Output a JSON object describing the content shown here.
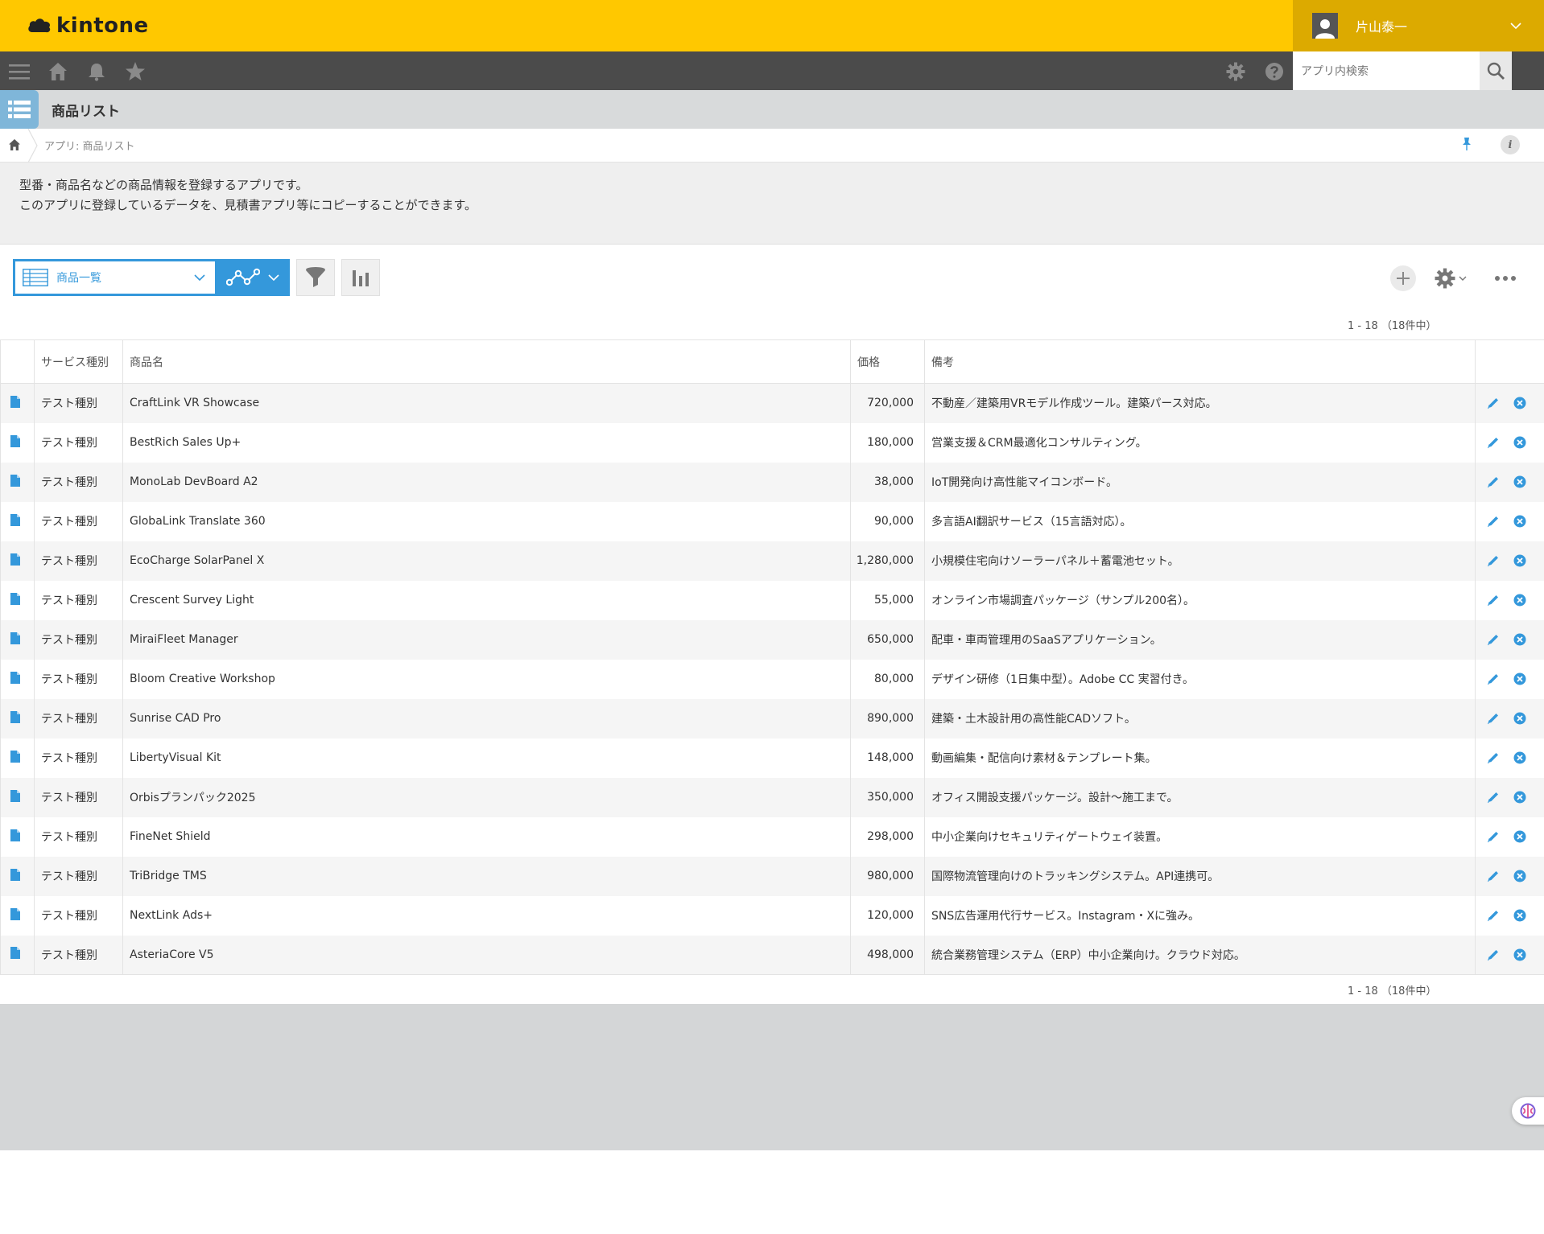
{
  "app": {
    "logo_text": "kintone",
    "title": "商品リスト"
  },
  "user": {
    "name": "片山泰一"
  },
  "search": {
    "placeholder": "アプリ内検索"
  },
  "breadcrumb": {
    "text": "アプリ: 商品リスト"
  },
  "description": {
    "line1": "型番・商品名などの商品情報を登録するアプリです。",
    "line2": "このアプリに登録しているデータを、見積書アプリ等にコピーすることができます。"
  },
  "view": {
    "selected": "商品一覧"
  },
  "pager": {
    "top": "1 - 18 （18件中）",
    "bottom": "1 - 18 （18件中）"
  },
  "colors": {
    "header_yellow": "#ffc800",
    "nav_dark": "#4b4b4b",
    "accent_blue": "#3498db"
  },
  "icons": [
    "menu-icon",
    "home-icon",
    "bell-icon",
    "star-icon",
    "gear-icon",
    "help-icon",
    "search-icon",
    "pin-icon",
    "info-icon",
    "record-icon",
    "pencil-icon",
    "close-icon"
  ],
  "table": {
    "headers": {
      "service_type": "サービス種別",
      "product_name": "商品名",
      "price": "価格",
      "notes": "備考"
    },
    "rows": [
      {
        "service_type": "テスト種別",
        "product_name": "CraftLink VR Showcase",
        "price": "720,000",
        "notes": "不動産／建築用VRモデル作成ツール。建築パース対応。"
      },
      {
        "service_type": "テスト種別",
        "product_name": "BestRich Sales Up+",
        "price": "180,000",
        "notes": "営業支援＆CRM最適化コンサルティング。"
      },
      {
        "service_type": "テスト種別",
        "product_name": "MonoLab DevBoard A2",
        "price": "38,000",
        "notes": "IoT開発向け高性能マイコンボード。"
      },
      {
        "service_type": "テスト種別",
        "product_name": "GlobaLink Translate 360",
        "price": "90,000",
        "notes": "多言語AI翻訳サービス（15言語対応）。"
      },
      {
        "service_type": "テスト種別",
        "product_name": "EcoCharge SolarPanel X",
        "price": "1,280,000",
        "notes": "小規模住宅向けソーラーパネル＋蓄電池セット。"
      },
      {
        "service_type": "テスト種別",
        "product_name": "Crescent Survey Light",
        "price": "55,000",
        "notes": "オンライン市場調査パッケージ（サンプル200名）。"
      },
      {
        "service_type": "テスト種別",
        "product_name": "MiraiFleet Manager",
        "price": "650,000",
        "notes": "配車・車両管理用のSaaSアプリケーション。"
      },
      {
        "service_type": "テスト種別",
        "product_name": "Bloom Creative Workshop",
        "price": "80,000",
        "notes": "デザイン研修（1日集中型）。Adobe CC 実習付き。"
      },
      {
        "service_type": "テスト種別",
        "product_name": "Sunrise CAD Pro",
        "price": "890,000",
        "notes": "建築・土木設計用の高性能CADソフト。"
      },
      {
        "service_type": "テスト種別",
        "product_name": "LibertyVisual Kit",
        "price": "148,000",
        "notes": "動画編集・配信向け素材＆テンプレート集。"
      },
      {
        "service_type": "テスト種別",
        "product_name": "Orbisプランパック2025",
        "price": "350,000",
        "notes": "オフィス開設支援パッケージ。設計〜施工まで。"
      },
      {
        "service_type": "テスト種別",
        "product_name": "FineNet Shield",
        "price": "298,000",
        "notes": "中小企業向けセキュリティゲートウェイ装置。"
      },
      {
        "service_type": "テスト種別",
        "product_name": "TriBridge TMS",
        "price": "980,000",
        "notes": "国際物流管理向けのトラッキングシステム。API連携可。"
      },
      {
        "service_type": "テスト種別",
        "product_name": "NextLink Ads+",
        "price": "120,000",
        "notes": "SNS広告運用代行サービス。Instagram・Xに強み。"
      },
      {
        "service_type": "テスト種別",
        "product_name": "AsteriaCore V5",
        "price": "498,000",
        "notes": "統合業務管理システム（ERP）中小企業向け。クラウド対応。"
      }
    ]
  }
}
